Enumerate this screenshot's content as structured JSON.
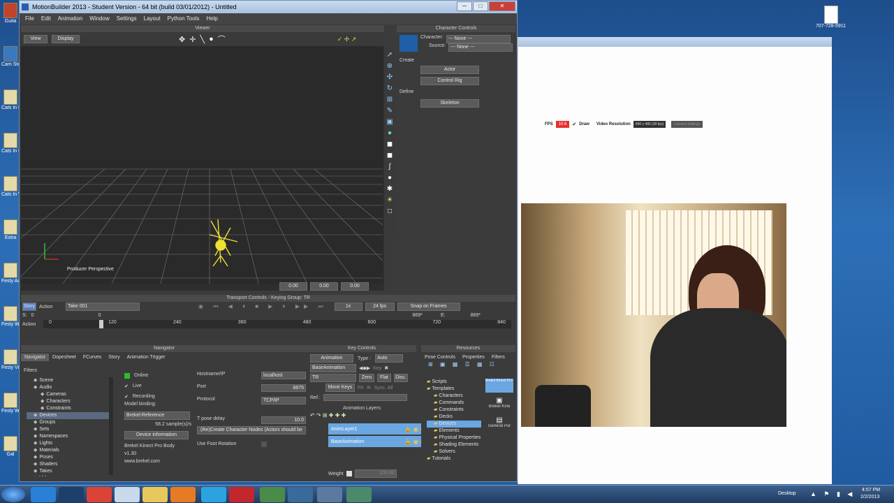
{
  "desktop": {
    "icons": [
      {
        "label": "Guita",
        "color": "#c0442c"
      },
      {
        "label": "Cam Stud",
        "color": "#3a78c0"
      },
      {
        "label": "Cats In Book",
        "color": "#e4d9a8"
      },
      {
        "label": "Cats In Const",
        "color": "#e4d9a8"
      },
      {
        "label": "Cats In Web",
        "color": "#e4d9a8"
      },
      {
        "label": "Extra",
        "color": "#e4d9a8"
      },
      {
        "label": "Festy Acad",
        "color": "#e4d9a8"
      },
      {
        "label": "Festy Web",
        "color": "#e4d9a8"
      },
      {
        "label": "Festy Video",
        "color": "#e4d9a8"
      },
      {
        "label": "Festy Web",
        "color": "#e4d9a8"
      },
      {
        "label": "Gal",
        "color": "#e4d9a8"
      }
    ],
    "right_icon_label": "707-728-5911"
  },
  "mb": {
    "title": "MotionBuilder 2013 - Student Version - 64 bit (build 03/01/2012) - Untitled",
    "menu": [
      "File",
      "Edit",
      "Animation",
      "Window",
      "Settings",
      "Layout",
      "Python Tools",
      "Help"
    ],
    "viewer": {
      "title": "Viewer",
      "view_btn": "View",
      "display_btn": "Display",
      "perspective_label": "Producer Perspective",
      "status_values": [
        "0.00",
        "0.00",
        "0.00"
      ]
    },
    "character_controls": {
      "title": "Character Controls",
      "character_label": "Character:",
      "character_value": "--- None ---",
      "source_label": "Source:",
      "source_value": "--- None ---",
      "create_label": "Create",
      "actor_btn": "Actor",
      "control_rig_btn": "Control Rig",
      "define_label": "Define",
      "skeleton_btn": "Skeleton"
    },
    "transport": {
      "title": "Transport Controls - Keying Group: TR",
      "story_btn": "Story",
      "action_btn": "Action",
      "take": "Take 001",
      "speed": "1x",
      "fps": "24 fps",
      "snap": "Snap on Frames",
      "s_label": "S:",
      "s_value": "0",
      "cur_frame": "0",
      "end_value": "869*",
      "e_label": "E:",
      "e_value": "869*",
      "action_label": "Action",
      "ticks": [
        "0",
        "120",
        "240",
        "360",
        "480",
        "600",
        "720",
        "840"
      ]
    },
    "navigator": {
      "title": "Navigator",
      "tabs": [
        "Navigator",
        "Dopesheet",
        "FCurves",
        "Story",
        "Animation Trigger"
      ],
      "filters": "Filters",
      "tree": [
        "Scene",
        "Audio",
        "Cameras",
        "Characters",
        "Constraints",
        "Devices",
        "Groups",
        "Sets",
        "Namespaces",
        "Lights",
        "Materials",
        "Poses",
        "Shaders",
        "Takes",
        "Video"
      ],
      "device": {
        "online": "Online",
        "live": "Live",
        "recording": "Recording",
        "model_binding": "Model binding:",
        "binding_value": "Brekel:Reference",
        "samples": "58.2 sample(s)/s",
        "device_info_btn": "Device information",
        "info_line1": "Brekel Kinect Pro Body",
        "info_line2": "v1.30",
        "info_line3": "www.brekel.com",
        "hostname_label": "Hostname/IP",
        "hostname_value": "localhost",
        "port_label": "Port",
        "port_value": "8875",
        "protocol_label": "Protocol",
        "protocol_value": "TCP/IP",
        "tpose_label": "T pose delay",
        "tpose_value": "10.0",
        "recreate_btn": "(Re)Create Character Nodes (Actors should be",
        "foot_label": "Use Foot Rotation"
      }
    },
    "key_controls": {
      "title": "Key Controls",
      "animation_btn": "Animation",
      "type_label": "Type :",
      "type_value": "Auto",
      "layer_value": "BaseAnimation",
      "group_value": "TR",
      "key_btn": "Key",
      "zero_btn": "Zero",
      "flat_btn": "Flat",
      "disc_btn": "Disc.",
      "fk_btn": "FK",
      "ik_btn": "IK",
      "move_keys_btn": "Move Keys",
      "sync_btn": "Sync. All",
      "ref_label": "Ref.:",
      "anim_layers_title": "Animation Layers",
      "layer1": "AnimLayer1",
      "layer2": "BaseAnimation",
      "weight_label": "Weight",
      "weight_value": "100.00"
    },
    "resources": {
      "title": "Resources",
      "tabs": [
        "Pose Controls",
        "Properties",
        "Filters"
      ],
      "tree": [
        "Scripts",
        "Templates",
        "Characters",
        "Commands",
        "Constraints",
        "Decks",
        "Devices",
        "Elements",
        "Physical Properties",
        "Shading Elements",
        "Solvers",
        "Tutorials"
      ],
      "selected": "Devices",
      "thumb1": "Brekel Kinect Pro Body",
      "thumb2": "Brekel Kine",
      "thumb3": "General Pur"
    }
  },
  "app2": {
    "fps_label": "FPS",
    "fps_value": "10.6",
    "draw_label": "Draw",
    "res_label": "Video Resolution",
    "res_value": "640 x 480 (30 fps)",
    "cam_settings": "Camera Settings"
  },
  "taskbar": {
    "desktop_label": "Desktop",
    "time": "4:57 PM",
    "date": "2/2/2013"
  }
}
